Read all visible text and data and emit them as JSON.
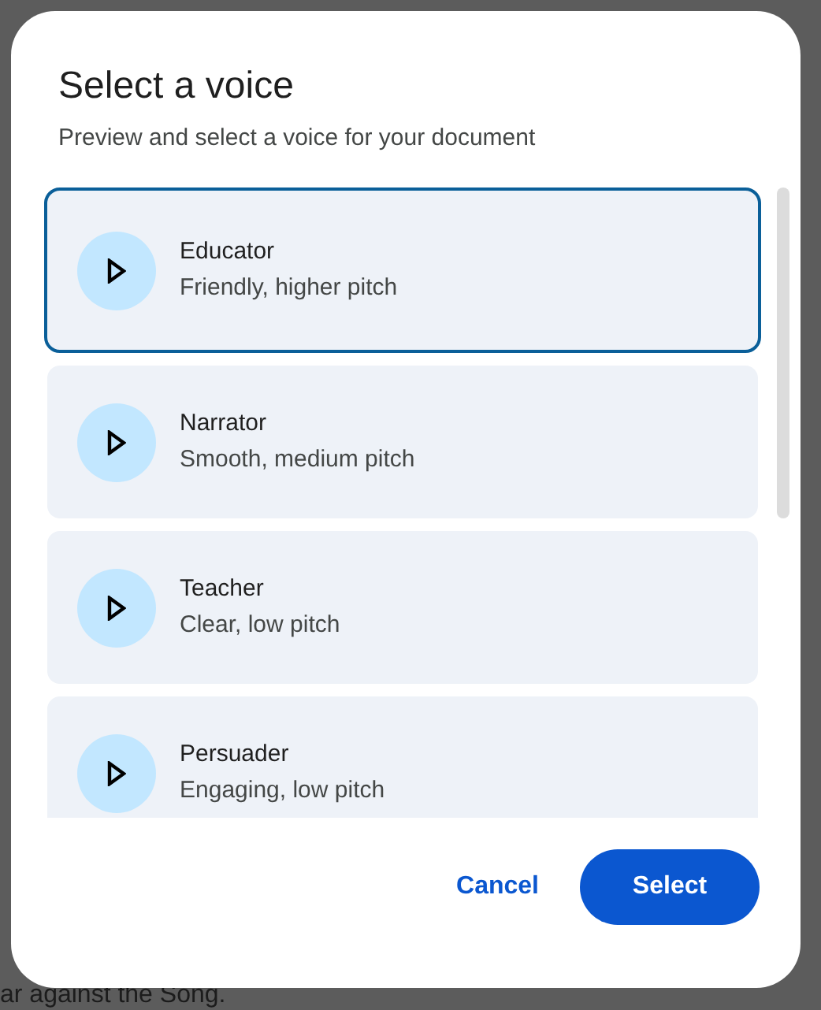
{
  "background": {
    "text": "ar against the Song."
  },
  "dialog": {
    "title": "Select a voice",
    "subtitle": "Preview and select a voice for your document",
    "voices": [
      {
        "name": "Educator",
        "description": "Friendly, higher pitch",
        "selected": true
      },
      {
        "name": "Narrator",
        "description": "Smooth, medium pitch",
        "selected": false
      },
      {
        "name": "Teacher",
        "description": "Clear, low pitch",
        "selected": false
      },
      {
        "name": "Persuader",
        "description": "Engaging, low pitch",
        "selected": false
      }
    ],
    "buttons": {
      "cancel": "Cancel",
      "confirm": "Select"
    }
  }
}
